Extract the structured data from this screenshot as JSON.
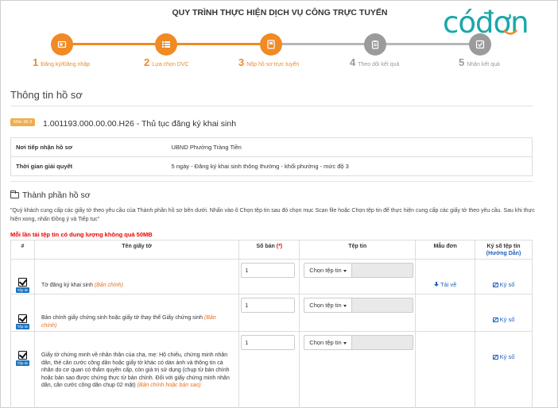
{
  "header": {
    "title": "QUY TRÌNH THỰC HIỆN DỊCH VỤ CÔNG TRỰC TUYẾN"
  },
  "logo": {
    "text": "cóđơn"
  },
  "colors": {
    "active": "#f08a24",
    "inactive": "#9b9b9b",
    "link": "#1f5fbf",
    "warning": "#ee0000"
  },
  "steps": [
    {
      "num": "1",
      "label": "Đăng ký/Đăng nhập",
      "state": "active",
      "icon": "login-icon"
    },
    {
      "num": "2",
      "label": "Lựa chọn DVC",
      "state": "active",
      "icon": "list-icon"
    },
    {
      "num": "3",
      "label": "Nộp hồ sơ trực tuyến",
      "state": "active",
      "icon": "submit-icon"
    },
    {
      "num": "4",
      "label": "Theo dõi kết quả",
      "state": "inactive",
      "icon": "clipboard-icon"
    },
    {
      "num": "5",
      "label": "Nhận kết quả",
      "state": "inactive",
      "icon": "check-icon"
    }
  ],
  "section": {
    "title": "Thông tin hồ sơ"
  },
  "procedure": {
    "level": "Mức độ 3",
    "code": "1.001193.000.00.00.H26",
    "name": "Thủ tục đăng ký khai sinh",
    "separator": " - "
  },
  "info": [
    {
      "key": "Nơi tiếp nhận hồ sơ",
      "value": "UBND Phường Tràng Tiền"
    },
    {
      "key": "Thời gian giải quyết",
      "value": "5 ngày - Đăng ký khai sinh thông thường - khối phường - mức độ 3"
    }
  ],
  "components": {
    "title": "Thành phần hồ sơ",
    "instructions": "\"Quý khách cung cấp các giấy tờ theo yêu cầu của Thành phần hồ sơ bên dưới. Nhấn vào ô Chọn tệp tin sau đó chọn mục Scan file hoặc Chọn tệp tin để thực hiện cung cấp các giấy tờ theo yêu cầu. Sau khi thực hiện xong, nhấn Đồng ý và Tiếp tục\"",
    "warning": "Mỗi lần tải tệp tin có dung lượng không quá 50MB"
  },
  "table": {
    "headers": {
      "num": "#",
      "name": "Tên giấy tờ",
      "copies": "Số bản",
      "copies_req": "(*)",
      "file": "Tệp tin",
      "template": "Mẫu đơn",
      "sign": "Ký số tệp tin",
      "sign_guide": "(Hướng Dẫn)"
    },
    "file_button": "Chọn tệp tin",
    "tag_label": "Tệp tin",
    "rows": [
      {
        "name": "Tờ đăng ký khai sinh",
        "note": "(Bản chính)",
        "copies": "1",
        "template": "Tải về",
        "sign": "Ký số"
      },
      {
        "name": "Bản chính giấy chứng sinh hoặc giấy tờ thay thế Giấy chứng sinh",
        "note": "(Bản chính)",
        "copies": "1",
        "template": "",
        "sign": "Ký số"
      },
      {
        "name": "Giấy tờ chứng minh về nhân thân của cha, mẹ: Hộ chiếu, chứng minh nhân dân, thẻ căn cước công dân hoặc giấy tờ khác có dán ảnh và thông tin cá nhân do cơ quan có thẩm quyền cấp, còn giá trị sử dụng (chụp từ bản chính hoặc bản sao được chứng thực từ bản chính. Đối với giấy chứng minh nhân dân, căn cước công dân chụp 02 mặt)",
        "note": "(Bản chính hoặc bản sao)",
        "copies": "1",
        "template": "",
        "sign": "Ký số"
      }
    ]
  }
}
